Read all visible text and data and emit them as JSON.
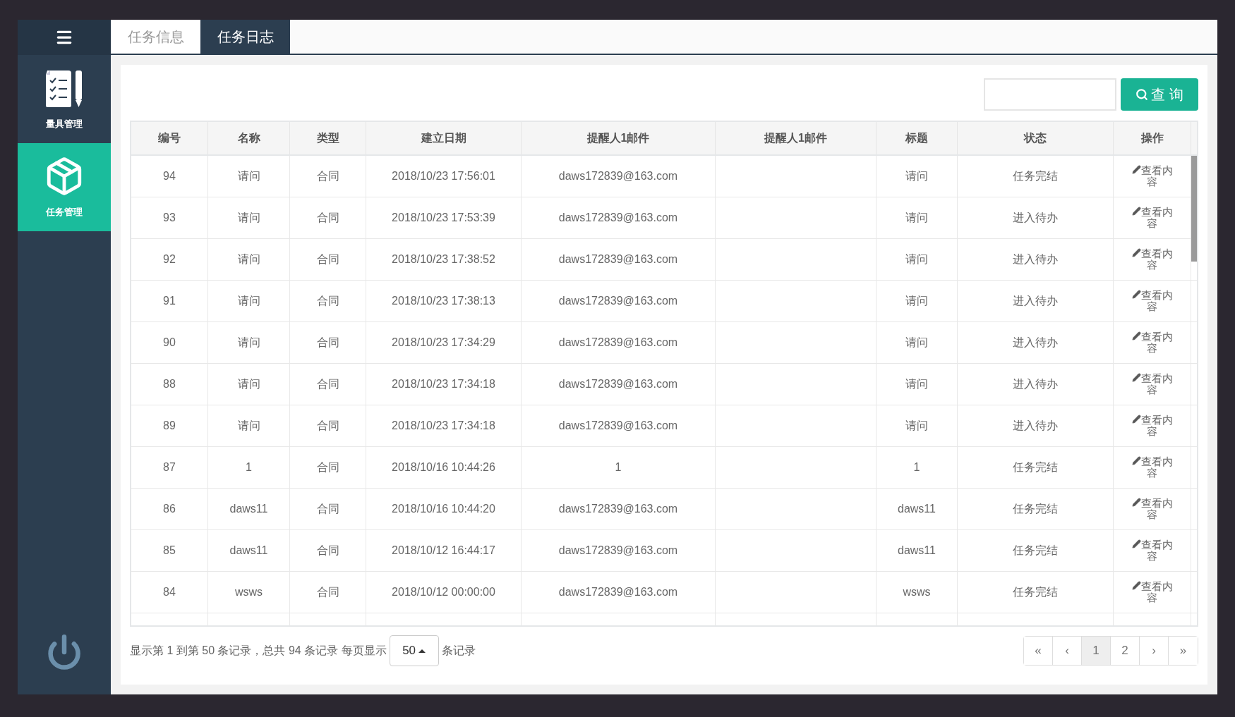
{
  "sidebar": {
    "items": [
      {
        "label": "量具管理",
        "kind": "checklist",
        "selected": false
      },
      {
        "label": "任务管理",
        "kind": "box",
        "selected": true
      }
    ]
  },
  "tabs": [
    {
      "label": "任务信息",
      "selected": false
    },
    {
      "label": "任务日志",
      "selected": true
    }
  ],
  "search": {
    "button": "查 询"
  },
  "table": {
    "columns": [
      "编号",
      "名称",
      "类型",
      "建立日期",
      "提醒人1邮件",
      "提醒人1邮件",
      "标题",
      "状态",
      "操作"
    ],
    "rows": [
      {
        "cells": [
          "94",
          "请问",
          "合同",
          "2018/10/23 17:56:01",
          "daws172839@163.com",
          "",
          "请问",
          "任务完结"
        ],
        "action": "查看内容"
      },
      {
        "cells": [
          "93",
          "请问",
          "合同",
          "2018/10/23 17:53:39",
          "daws172839@163.com",
          "",
          "请问",
          "进入待办"
        ],
        "action": "查看内容"
      },
      {
        "cells": [
          "92",
          "请问",
          "合同",
          "2018/10/23 17:38:52",
          "daws172839@163.com",
          "",
          "请问",
          "进入待办"
        ],
        "action": "查看内容"
      },
      {
        "cells": [
          "91",
          "请问",
          "合同",
          "2018/10/23 17:38:13",
          "daws172839@163.com",
          "",
          "请问",
          "进入待办"
        ],
        "action": "查看内容"
      },
      {
        "cells": [
          "90",
          "请问",
          "合同",
          "2018/10/23 17:34:29",
          "daws172839@163.com",
          "",
          "请问",
          "进入待办"
        ],
        "action": "查看内容"
      },
      {
        "cells": [
          "88",
          "请问",
          "合同",
          "2018/10/23 17:34:18",
          "daws172839@163.com",
          "",
          "请问",
          "进入待办"
        ],
        "action": "查看内容"
      },
      {
        "cells": [
          "89",
          "请问",
          "合同",
          "2018/10/23 17:34:18",
          "daws172839@163.com",
          "",
          "请问",
          "进入待办"
        ],
        "action": "查看内容"
      },
      {
        "cells": [
          "87",
          "1",
          "合同",
          "2018/10/16 10:44:26",
          "1",
          "",
          "1",
          "任务完结"
        ],
        "action": "查看内容"
      },
      {
        "cells": [
          "86",
          "daws11",
          "合同",
          "2018/10/16 10:44:20",
          "daws172839@163.com",
          "",
          "daws11",
          "任务完结"
        ],
        "action": "查看内容"
      },
      {
        "cells": [
          "85",
          "daws11",
          "合同",
          "2018/10/12 16:44:17",
          "daws172839@163.com",
          "",
          "daws11",
          "任务完结"
        ],
        "action": "查看内容"
      },
      {
        "cells": [
          "84",
          "wsws",
          "合同",
          "2018/10/12 00:00:00",
          "daws172839@163.com",
          "",
          "wsws",
          "任务完结"
        ],
        "action": "查看内容"
      }
    ]
  },
  "footer": {
    "summary": "显示第 1 到第 50 条记录，总共 94 条记录 每页显示",
    "page_size": "50",
    "suffix": "条记录"
  },
  "pagination": [
    {
      "label": "«",
      "selected": false
    },
    {
      "label": "‹",
      "selected": false
    },
    {
      "label": "1",
      "selected": true
    },
    {
      "label": "2",
      "selected": false
    },
    {
      "label": "›",
      "selected": false
    },
    {
      "label": "»",
      "selected": false
    }
  ]
}
